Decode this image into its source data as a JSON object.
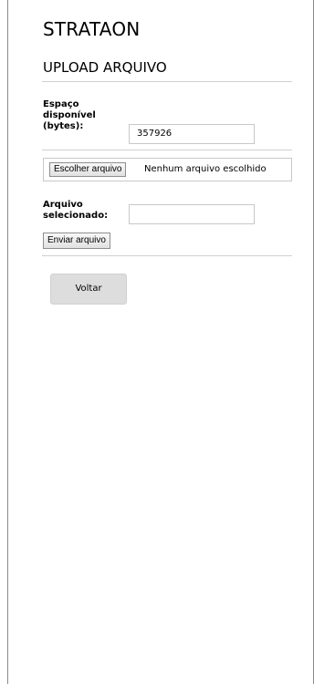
{
  "app": {
    "brand": "STRATAON"
  },
  "page": {
    "title": "UPLOAD ARQUIVO"
  },
  "storage": {
    "label_line1": "Espaço",
    "label_line2": "disponível",
    "label_line3": "(bytes):",
    "value": "357926"
  },
  "file_picker": {
    "button_label": "Escolher arquivo",
    "status_text": "Nenhum arquivo escolhido"
  },
  "selected_file": {
    "label_line1": "Arquivo",
    "label_line2": "selecionado:",
    "value": ""
  },
  "actions": {
    "send_label": "Enviar arquivo",
    "back_label": "Voltar"
  }
}
